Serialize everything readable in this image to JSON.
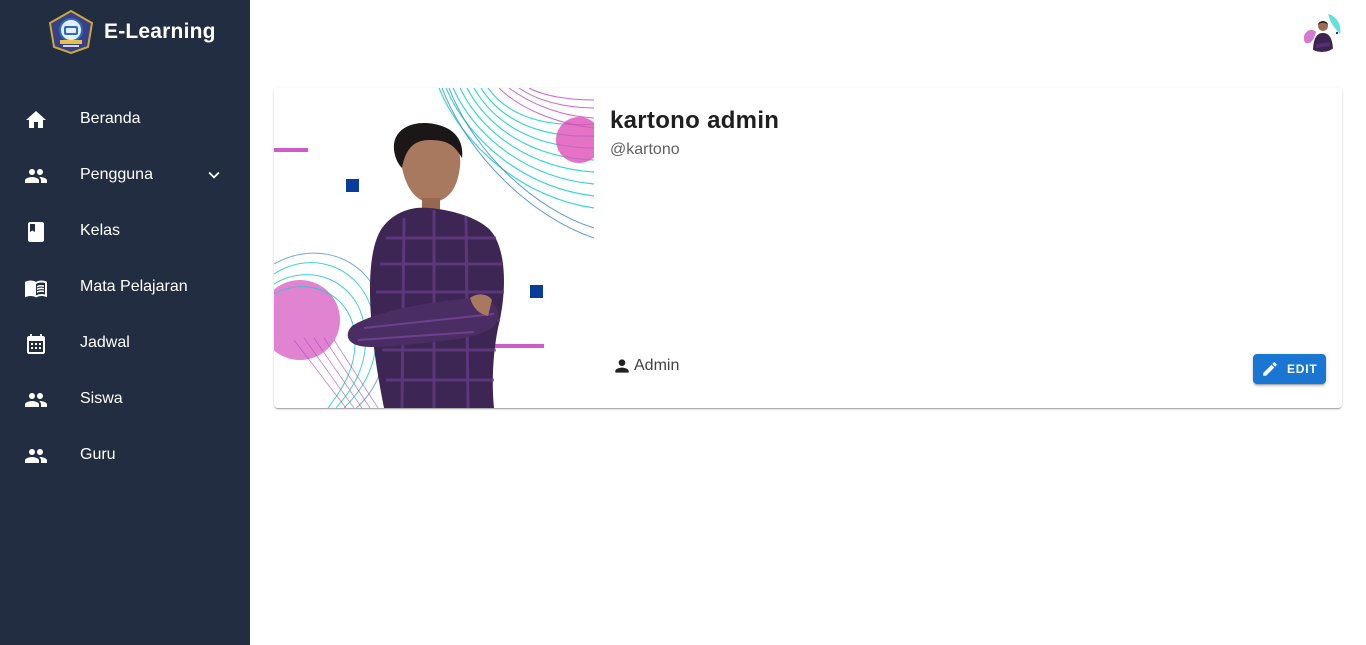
{
  "app": {
    "title": "E-Learning"
  },
  "sidebar": {
    "items": [
      {
        "label": "Beranda",
        "icon": "home-icon"
      },
      {
        "label": "Pengguna",
        "icon": "people-icon",
        "expandable": true
      },
      {
        "label": "Kelas",
        "icon": "book-icon"
      },
      {
        "label": "Mata Pelajaran",
        "icon": "menu-book-icon"
      },
      {
        "label": "Jadwal",
        "icon": "calendar-icon"
      },
      {
        "label": "Siswa",
        "icon": "people-icon"
      },
      {
        "label": "Guru",
        "icon": "people-icon"
      }
    ]
  },
  "profile": {
    "name": "kartono admin",
    "username": "@kartono",
    "role": "Admin",
    "edit_label": "EDIT"
  },
  "colors": {
    "sidebar_bg": "#222d42",
    "accent": "#1976d2",
    "text_primary": "#1f1f1f",
    "text_secondary": "#616161"
  }
}
